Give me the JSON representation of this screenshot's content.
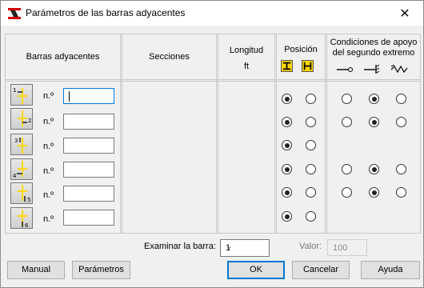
{
  "window": {
    "title": "Parámetros de las barras adyacentes",
    "close_glyph": "✕"
  },
  "header": {
    "adjacent_bars": "Barras adyacentes",
    "sections": "Secciones",
    "length_line1": "Longitud",
    "length_line2": "ft",
    "position": "Posición",
    "support_line1": "Condiciones de apoyo",
    "support_line2": "del segundo extremo"
  },
  "rows": [
    {
      "index": "1",
      "n_label": "n.º",
      "value": "",
      "position": [
        true,
        false
      ],
      "support": [
        false,
        true,
        false
      ]
    },
    {
      "index": "2",
      "n_label": "n.º",
      "value": "",
      "position": [
        true,
        false
      ],
      "support": [
        false,
        true,
        false
      ]
    },
    {
      "index": "3",
      "n_label": "n.º",
      "value": "",
      "position": [
        true,
        false
      ],
      "support": null
    },
    {
      "index": "4",
      "n_label": "n.º",
      "value": "",
      "position": [
        true,
        false
      ],
      "support": [
        false,
        true,
        false
      ]
    },
    {
      "index": "5",
      "n_label": "n.º",
      "value": "",
      "position": [
        true,
        false
      ],
      "support": [
        false,
        true,
        false
      ]
    },
    {
      "index": "6",
      "n_label": "n.º",
      "value": "",
      "position": [
        true,
        false
      ],
      "support": null
    }
  ],
  "footer": {
    "examine_label": "Examinar la barra:",
    "examine_value": "1",
    "value_label": "Valor:",
    "value_value": "100"
  },
  "buttons": {
    "manual": "Manual",
    "parameters": "Parámetros",
    "ok": "OK",
    "cancel": "Cancelar",
    "help": "Ayuda"
  },
  "colors": {
    "accent": "#0078d7",
    "icon_yellow": "#ffd800",
    "title_icon_red": "#d40000"
  }
}
